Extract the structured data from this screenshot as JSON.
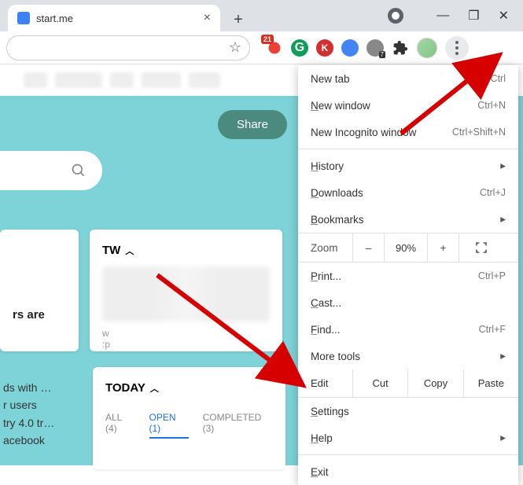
{
  "tab": {
    "title": "start.me"
  },
  "ext_badges": {
    "first": "21"
  },
  "page": {
    "share": "Share",
    "card_left_heading": "rs are",
    "card_tw_title": "TW",
    "textlines": [
      "ds with …",
      "r users",
      "try 4.0 tr…",
      "acebook"
    ],
    "today_title": "TODAY",
    "filters": {
      "all": "ALL (4)",
      "open": "OPEN (1)",
      "completed": "COMPLETED (3)"
    }
  },
  "menu": {
    "new_tab": "New tab",
    "new_tab_sc": "Ctrl",
    "new_window": "New window",
    "new_window_u": "N",
    "new_window_sc": "Ctrl+N",
    "incognito": "New Incognito window",
    "incognito_sc": "Ctrl+Shift+N",
    "history": "History",
    "history_u": "H",
    "downloads": "Downloads",
    "downloads_u": "D",
    "downloads_sc": "Ctrl+J",
    "bookmarks": "Bookmarks",
    "bookmarks_u": "B",
    "zoom_label": "Zoom",
    "zoom_value": "90%",
    "print": "Print...",
    "print_u": "P",
    "print_sc": "Ctrl+P",
    "cast": "Cast...",
    "cast_u": "C",
    "find": "Find...",
    "find_u": "F",
    "find_sc": "Ctrl+F",
    "more_tools": "More tools",
    "edit_label": "Edit",
    "cut": "Cut",
    "copy": "Copy",
    "paste": "Paste",
    "settings": "Settings",
    "settings_u": "S",
    "help": "Help",
    "help_u": "H",
    "exit": "Exit",
    "exit_u": "E"
  }
}
